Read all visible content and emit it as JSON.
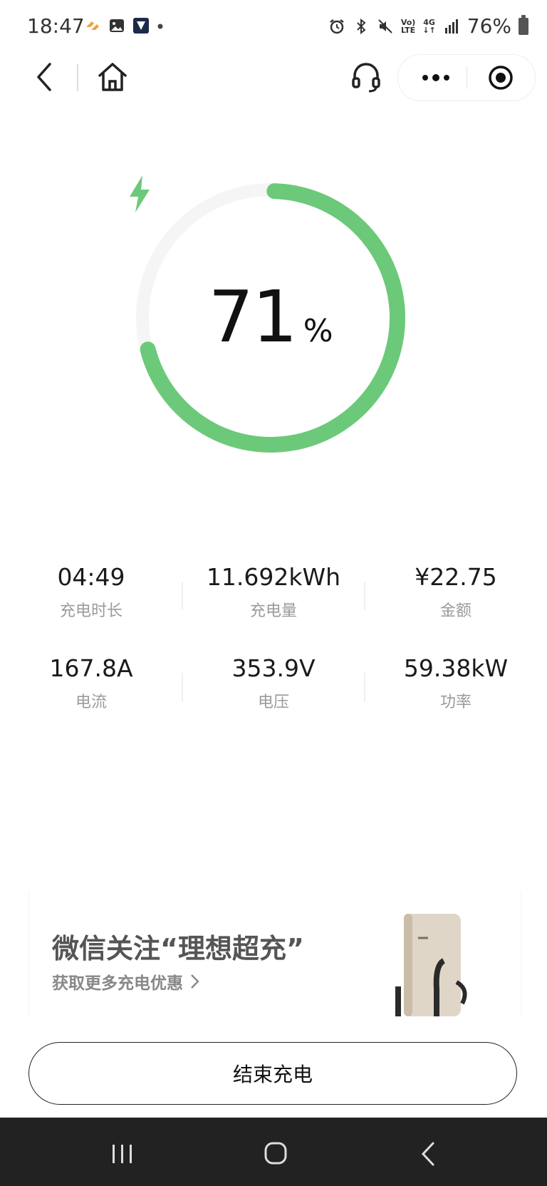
{
  "status_bar": {
    "time": "18:47",
    "battery": "76%",
    "network": "4G",
    "icons": [
      "app-notification-icon",
      "gallery-icon",
      "app-icon",
      "dot-icon",
      "alarm-icon",
      "bluetooth-icon",
      "mute-icon",
      "volte-icon",
      "signal-icon",
      "battery-icon"
    ]
  },
  "nav": {
    "icons": [
      "back-icon",
      "home-icon",
      "headset-icon",
      "more-icon",
      "close-target-icon"
    ]
  },
  "charge": {
    "percent": "71",
    "percent_unit": "%",
    "progress": 0.71,
    "color": "#6cc97a"
  },
  "stats": [
    {
      "value": "04:49",
      "label": "充电时长"
    },
    {
      "value": "11.692kWh",
      "label": "充电量"
    },
    {
      "value": "¥22.75",
      "label": "金额"
    },
    {
      "value": "167.8A",
      "label": "电流"
    },
    {
      "value": "353.9V",
      "label": "电压"
    },
    {
      "value": "59.38kW",
      "label": "功率"
    }
  ],
  "promo": {
    "title": "微信关注“理想超充”",
    "subtitle": "获取更多充电优惠"
  },
  "actions": {
    "end_label": "结束充电"
  }
}
